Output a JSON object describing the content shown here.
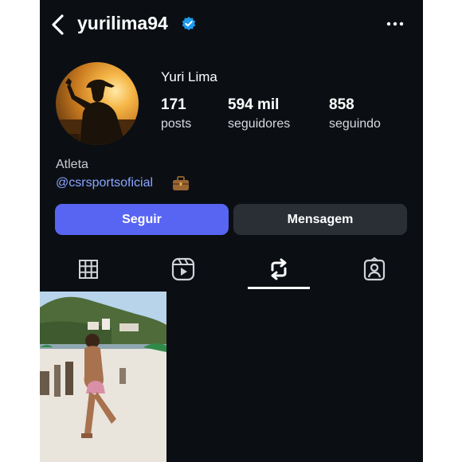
{
  "header": {
    "username": "yurilima94",
    "back_icon": "chevron-left-icon",
    "verified_icon": "verified-badge-icon",
    "more_icon": "more-horizontal-icon"
  },
  "profile": {
    "full_name": "Yuri Lima",
    "stats": [
      {
        "value": "171",
        "label": "posts"
      },
      {
        "value": "594 mil",
        "label": "seguidores"
      },
      {
        "value": "858",
        "label": "seguindo"
      }
    ],
    "bio_category": "Atleta",
    "bio_link": "@csrsportsoficial",
    "bio_emoji_icon": "briefcase-icon"
  },
  "actions": {
    "follow_label": "Seguir",
    "message_label": "Mensagem"
  },
  "tabs": [
    {
      "icon": "grid-icon",
      "active": false
    },
    {
      "icon": "reels-icon",
      "active": false
    },
    {
      "icon": "reposts-icon",
      "active": true
    },
    {
      "icon": "tagged-icon",
      "active": false
    }
  ],
  "colors": {
    "background": "#0b0f14",
    "follow_button": "#5865f2",
    "message_button": "#2a2f36",
    "link": "#8aa5ff",
    "verified": "#1d9bf0"
  }
}
